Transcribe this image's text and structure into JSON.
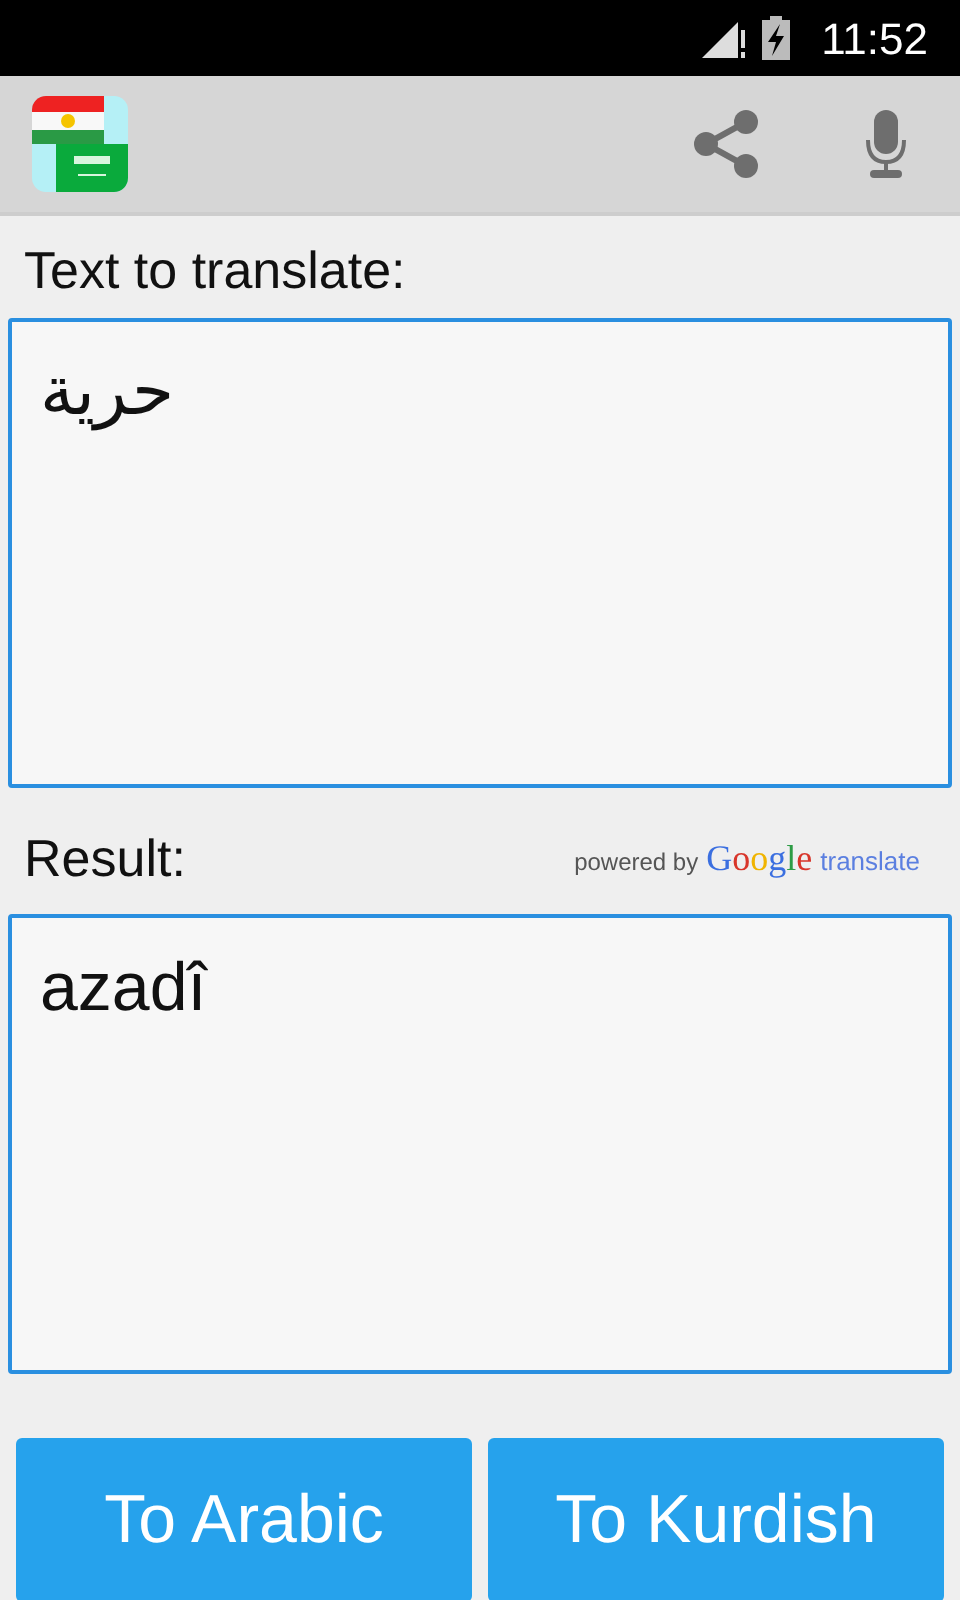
{
  "status_bar": {
    "time": "11:52"
  },
  "app_bar": {
    "actions": [
      {
        "kind": "share"
      },
      {
        "kind": "mic"
      }
    ]
  },
  "source": {
    "label": "Text to translate:",
    "value": "حرية"
  },
  "result": {
    "label": "Result:",
    "value": "azadî",
    "attribution": {
      "prefix": "powered by",
      "brand": "Google",
      "suffix": "translate"
    }
  },
  "buttons": [
    "To Arabic",
    "To Kurdish"
  ]
}
